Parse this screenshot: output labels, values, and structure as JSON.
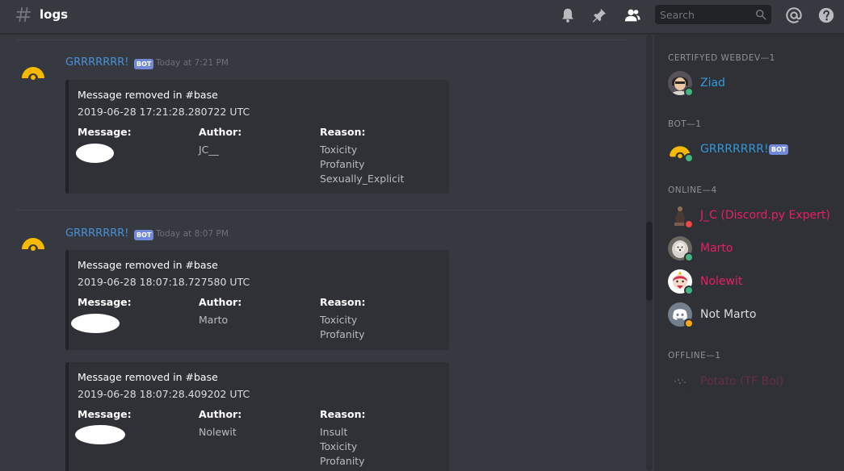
{
  "header": {
    "channel_name": "logs",
    "search_placeholder": "Search"
  },
  "messages": [
    {
      "author": "GRRRRRRR!",
      "bot_tag": "BOT",
      "timestamp": "Today at 7:21 PM",
      "embeds": [
        {
          "title": "Message removed in #base",
          "datetime": "2019-06-28 17:21:28.280722 UTC",
          "message_label": "Message:",
          "author_label": "Author:",
          "author_value": "JC__",
          "reason_label": "Reason:",
          "reasons": "Toxicity\nProfanity\nSexually_Explicit"
        }
      ]
    },
    {
      "author": "GRRRRRRR!",
      "bot_tag": "BOT",
      "timestamp": "Today at 8:07 PM",
      "embeds": [
        {
          "title": "Message removed in #base",
          "datetime": "2019-06-28 18:07:18.727580 UTC",
          "message_label": "Message:",
          "author_label": "Author:",
          "author_value": "Marto",
          "reason_label": "Reason:",
          "reasons": "Toxicity\nProfanity"
        },
        {
          "title": "Message removed in #base",
          "datetime": "2019-06-28 18:07:28.409202 UTC",
          "message_label": "Message:",
          "author_label": "Author:",
          "author_value": "Nolewit",
          "reason_label": "Reason:",
          "reasons": "Insult\nToxicity\nProfanity"
        }
      ]
    }
  ],
  "members": {
    "groups": [
      {
        "header": "CERTIFYED WEBDEV—1",
        "members": [
          {
            "name": "Ziad",
            "color": "#3498db",
            "status": "online"
          }
        ]
      },
      {
        "header": "BOT—1",
        "members": [
          {
            "name": "GRRRRRRR!",
            "color": "#3498db",
            "status": "online",
            "bot_tag": "BOT"
          }
        ]
      },
      {
        "header": "ONLINE—4",
        "members": [
          {
            "name": "J_C (Discord.py Expert)",
            "color": "#e91e63",
            "status": "dnd"
          },
          {
            "name": "Marto",
            "color": "#e91e63",
            "status": "online"
          },
          {
            "name": "Nolewit",
            "color": "#e91e63",
            "status": "online"
          },
          {
            "name": "Not Marto",
            "color": "#dcddde",
            "status": "idle"
          }
        ]
      },
      {
        "header": "OFFLINE—1",
        "members": [
          {
            "name": "Potato (TF Boi)",
            "color": "#6b2e45",
            "status": "offline"
          }
        ]
      }
    ]
  },
  "colors": {
    "bot_yellow": "#f6b900",
    "status_online": "#43b581",
    "status_dnd": "#f04747",
    "status_idle": "#faa61a"
  }
}
